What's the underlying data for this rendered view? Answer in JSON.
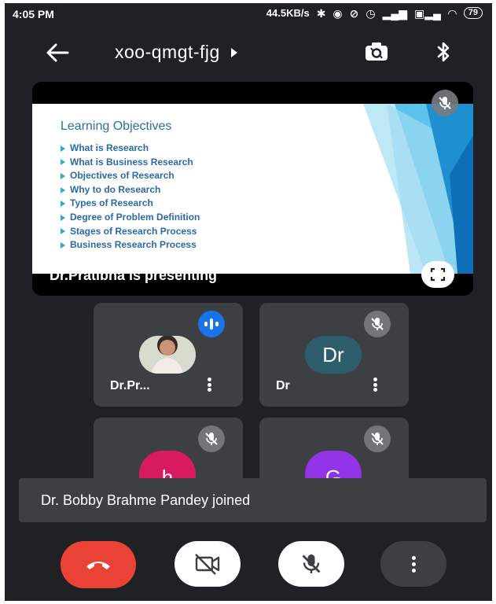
{
  "status_bar": {
    "time": "4:05 PM",
    "network_speed": "44.5KB/s",
    "battery": "79"
  },
  "top_bar": {
    "meeting_code": "xoo-qmgt-fjg"
  },
  "presentation": {
    "presenter_label": "Dr.Pratibha is presenting",
    "slide_title": "Learning Objectives",
    "slide_items": [
      "What is Research",
      "What is Business Research",
      "Objectives of Research",
      "Why to do Research",
      "Types of Research",
      "Degree of Problem Definition",
      "Stages of Research Process",
      "Business Research Process"
    ]
  },
  "participants": [
    {
      "name": "Dr.Pr...",
      "avatar_type": "photo",
      "speaking": true
    },
    {
      "name": "Dr",
      "initials": "Dr",
      "avatar_color": "#2e5e6e",
      "muted": true
    },
    {
      "initials": "h",
      "avatar_color": "#d81b60",
      "muted": true
    },
    {
      "initials": "G",
      "avatar_color": "#9334e6",
      "muted": true
    }
  ],
  "toast": {
    "message": "Dr. Bobby Brahme Pandey joined"
  },
  "icons": [
    "back-arrow-icon",
    "camera-switch-icon",
    "bluetooth-icon",
    "mic-off-icon",
    "fullscreen-icon",
    "end-call-icon",
    "camera-off-icon",
    "more-vert-icon"
  ]
}
